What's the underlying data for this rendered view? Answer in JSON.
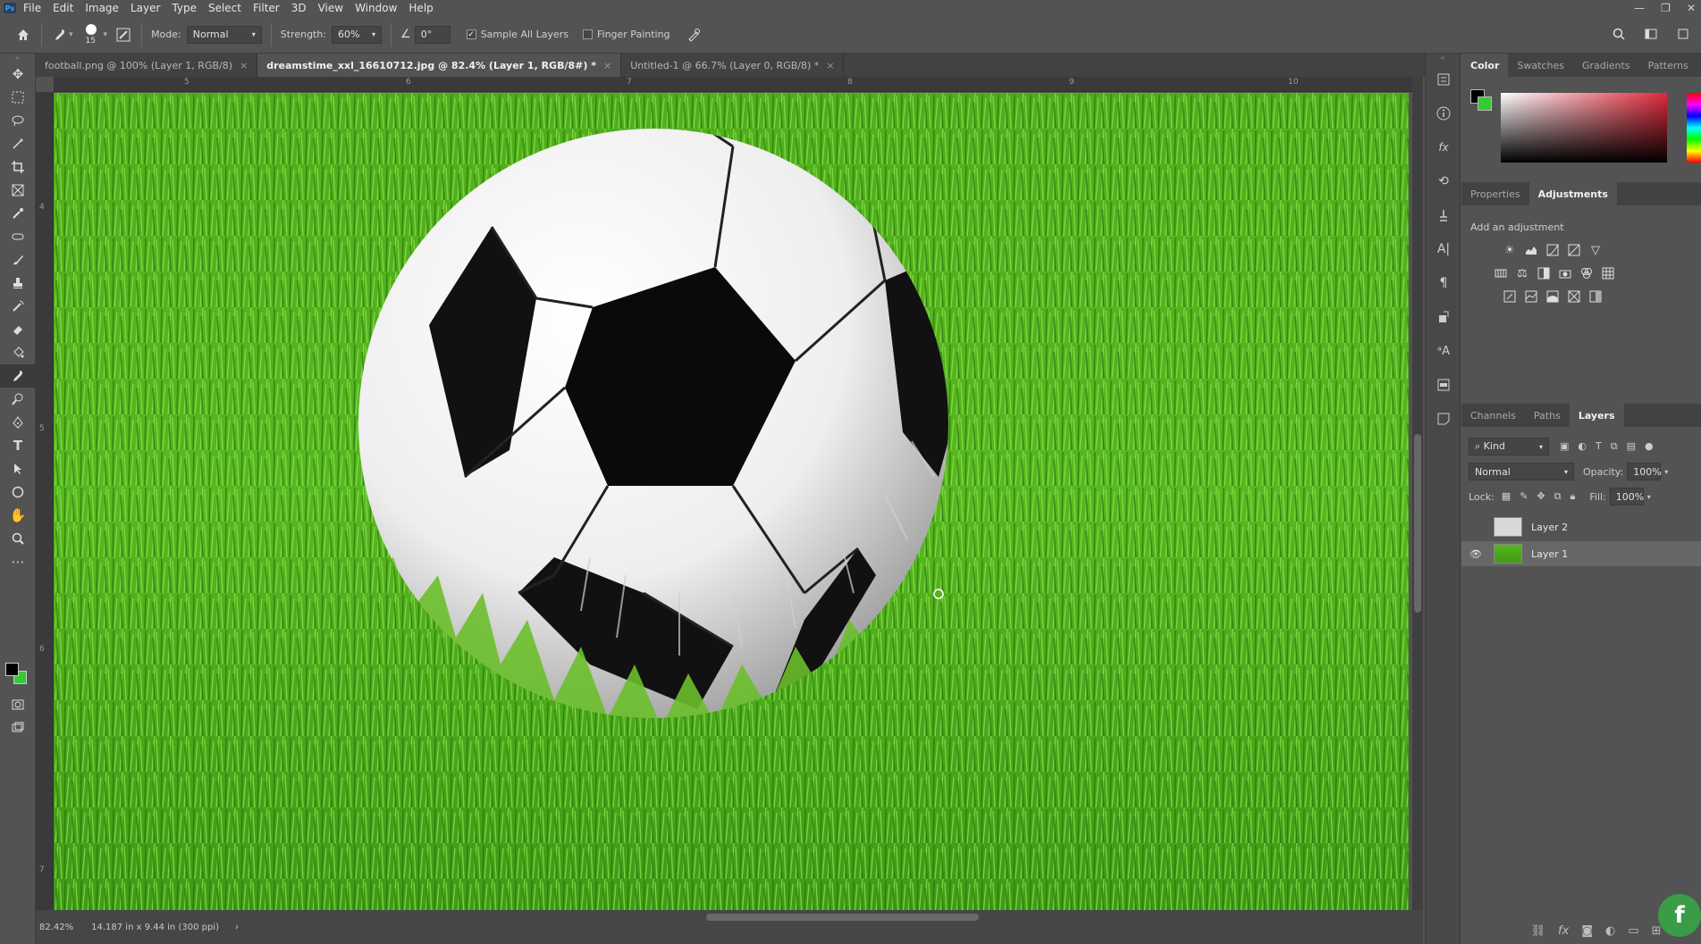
{
  "app": {
    "logo": "Ps",
    "menu": [
      "File",
      "Edit",
      "Image",
      "Layer",
      "Type",
      "Select",
      "Filter",
      "3D",
      "View",
      "Window",
      "Help"
    ],
    "window_controls": [
      "—",
      "❐",
      "✕"
    ]
  },
  "options": {
    "brush_size": "15",
    "mode_label": "Mode:",
    "mode_value": "Normal",
    "strength_label": "Strength:",
    "strength_value": "60%",
    "angle_value": "0°",
    "sample_all_layers": "Sample All Layers",
    "sample_all_layers_checked": true,
    "finger_painting": "Finger Painting",
    "finger_painting_checked": false
  },
  "tabs": [
    {
      "label": "football.png @ 100% (Layer 1, RGB/8)",
      "active": false
    },
    {
      "label": "dreamstime_xxl_16610712.jpg @ 82.4% (Layer 1, RGB/8#) *",
      "active": true
    },
    {
      "label": "Untitled-1 @ 66.7% (Layer 0, RGB/8) *",
      "active": false
    }
  ],
  "ruler": {
    "top_numbers": [
      "5",
      "6",
      "7",
      "8",
      "9",
      "10"
    ],
    "left_numbers": [
      "4",
      "5",
      "6",
      "7"
    ]
  },
  "status": {
    "zoom": "82.42%",
    "doc_size": "14.187 in x 9.44 in (300 ppi)",
    "arrow": "›"
  },
  "color_panel": {
    "tabs": [
      "Color",
      "Swatches",
      "Gradients",
      "Patterns"
    ],
    "active": "Color",
    "foreground": "#000000",
    "background": "#38c838"
  },
  "adjust_panel": {
    "tabs": [
      "Properties",
      "Adjustments"
    ],
    "active": "Adjustments",
    "add_label": "Add an adjustment"
  },
  "layers_panel": {
    "tabs": [
      "Channels",
      "Paths",
      "Layers"
    ],
    "active": "Layers",
    "kind_label": "Kind",
    "blend_mode": "Normal",
    "opacity_label": "Opacity:",
    "opacity_value": "100%",
    "lock_label": "Lock:",
    "fill_label": "Fill:",
    "fill_value": "100%",
    "layers": [
      {
        "name": "Layer 2",
        "visible": false,
        "selected": false
      },
      {
        "name": "Layer 1",
        "visible": true,
        "selected": true
      }
    ]
  },
  "icons": {
    "home": "home-icon",
    "smudge": "smudge-icon",
    "eye": "eye-icon"
  }
}
